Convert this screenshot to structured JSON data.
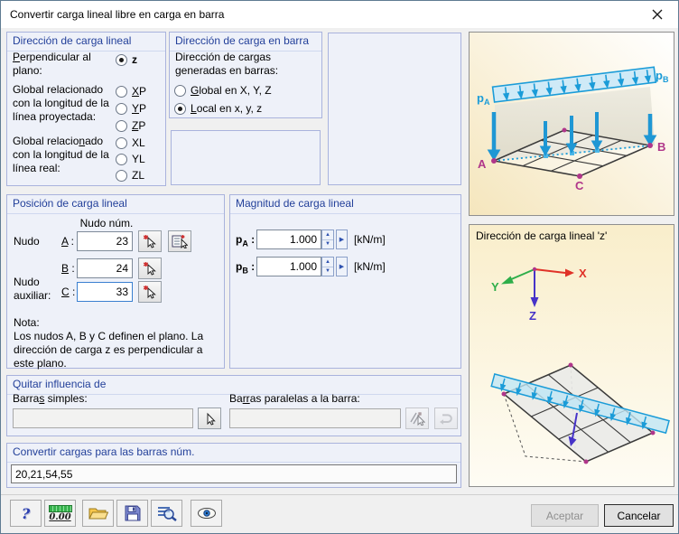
{
  "window": {
    "title": "Convertir carga lineal libre en carga en barra"
  },
  "dir_lineal": {
    "title": "Dirección de carga lineal",
    "perpendicular": {
      "key": "P",
      "rest": "erpendicular al plano:"
    },
    "proyectada_label": "Global relacionado con la longitud de la línea proyectada:",
    "real": {
      "pre": "Global relacio",
      "key": "n",
      "post": "ado con la longitud de la línea real:"
    },
    "opt_z": "z",
    "opt_xp": {
      "key": "X",
      "rest": "P"
    },
    "opt_yp": {
      "key": "Y",
      "rest": "P"
    },
    "opt_zp": {
      "key": "Z",
      "rest": "P"
    },
    "opt_xl": "XL",
    "opt_yl": "YL",
    "opt_zl": "ZL"
  },
  "dir_barra": {
    "title": "Dirección de carga en barra",
    "desc": "Dirección de cargas generadas en barras:",
    "opt_global": {
      "key": "G",
      "rest": "lobal en X, Y, Z"
    },
    "opt_local": {
      "key": "L",
      "rest": "ocal en x, y, z"
    }
  },
  "posicion": {
    "title": "Posición de carga lineal",
    "col_header": "Nudo núm.",
    "nudo_label": "Nudo",
    "aux_label": "Nudo auxiliar:",
    "a": {
      "key": "A",
      "colon": " :",
      "value": "23"
    },
    "b": {
      "key": "B",
      "colon": " :",
      "value": "24"
    },
    "c": {
      "key": "C",
      "colon": " :",
      "value": "33"
    },
    "note_title": "Nota:",
    "note_text": "Los nudos A, B y C definen el plano. La dirección de carga z es perpendicular a este plano."
  },
  "magnitud": {
    "title": "Magnitud de carga lineal",
    "pa": {
      "base": "p",
      "sub": "A",
      "colon": " :",
      "value": "1.000"
    },
    "pb": {
      "base": "p",
      "sub": "B",
      "colon": " :",
      "value": "1.000"
    },
    "unit": "[kN/m]"
  },
  "quitar": {
    "title": "Quitar influencia de",
    "simples": {
      "pre": "Barra",
      "key": "s",
      "post": " simples:"
    },
    "paralelas": {
      "pre": "Ba",
      "key": "rr",
      "post": "as paralelas a la barra:"
    }
  },
  "convertir": {
    "title": "Convertir cargas para las barras núm.",
    "value": "20,21,54,55"
  },
  "toolbar": {
    "help_glyph": "?",
    "units_label": "0.00"
  },
  "footer": {
    "accept": "Aceptar",
    "cancel": "Cancelar"
  },
  "panel_top": {
    "pa_base": "p",
    "pa_sub": "A",
    "pb_base": "p",
    "pb_sub": "B",
    "node_a": "A",
    "node_b": "B",
    "node_c": "C"
  },
  "panel_bottom": {
    "title": "Dirección de carga lineal 'z'",
    "axis_x": "X",
    "axis_y": "Y",
    "axis_z": "Z"
  },
  "icons": {
    "spin_up": "▲",
    "spin_down": "▼",
    "detail_arrow": "▶"
  },
  "colors": {
    "accent_load": "#1b9cd8",
    "node": "#b0368a",
    "axis_x": "#e03228",
    "axis_y": "#2eae4a",
    "axis_z": "#4633c8",
    "group_header": "#23409a"
  }
}
